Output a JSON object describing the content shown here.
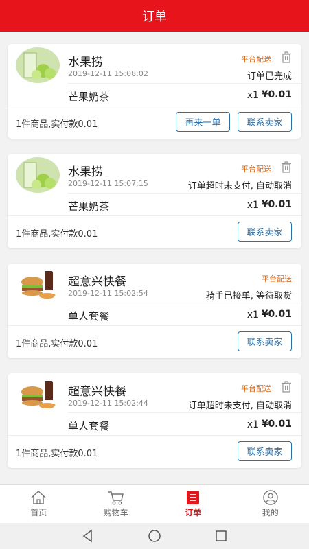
{
  "header": {
    "title": "订单"
  },
  "orders": [
    {
      "shop": "水果捞",
      "time": "2019-12-11 15:08:02",
      "delivery": "平台配送",
      "status": "订单已完成",
      "item": "芒果奶茶",
      "qty": "x1",
      "price": "¥0.01",
      "summary": "1件商品,实付款0.01",
      "reorder_label": "再来一单",
      "contact_label": "联系卖家"
    },
    {
      "shop": "水果捞",
      "time": "2019-12-11 15:07:15",
      "delivery": "平台配送",
      "status": "订单超时未支付, 自动取消",
      "item": "芒果奶茶",
      "qty": "x1",
      "price": "¥0.01",
      "summary": "1件商品,实付款0.01",
      "contact_label": "联系卖家"
    },
    {
      "shop": "超意兴快餐",
      "time": "2019-12-11 15:02:54",
      "delivery": "平台配送",
      "status": "骑手已接单, 等待取货",
      "item": "单人套餐",
      "qty": "x1",
      "price": "¥0.01",
      "summary": "1件商品,实付款0.01",
      "contact_label": "联系卖家"
    },
    {
      "shop": "超意兴快餐",
      "time": "2019-12-11 15:02:44",
      "delivery": "平台配送",
      "status": "订单超时未支付, 自动取消",
      "item": "单人套餐",
      "qty": "x1",
      "price": "¥0.01",
      "summary": "1件商品,实付款0.01",
      "contact_label": "联系卖家"
    }
  ],
  "tabs": [
    {
      "label": "首页",
      "icon": "home-icon"
    },
    {
      "label": "购物车",
      "icon": "cart-icon"
    },
    {
      "label": "订单",
      "icon": "order-list-icon"
    },
    {
      "label": "我的",
      "icon": "user-icon"
    }
  ],
  "colors": {
    "brand": "#e8141b",
    "button": "#2a6fa8",
    "delivery": "#d2691e"
  }
}
